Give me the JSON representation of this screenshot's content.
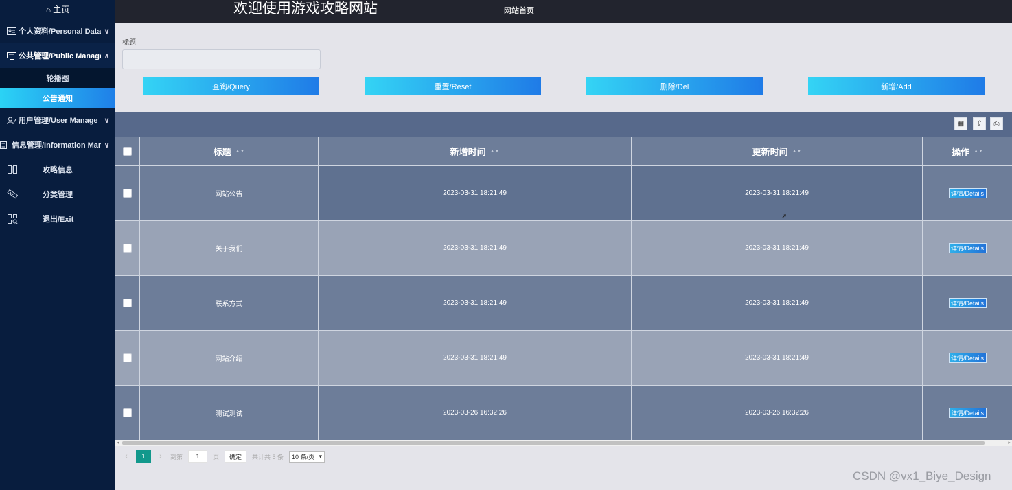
{
  "sidebar": {
    "home_label": "主页",
    "groups": [
      {
        "label": "个人资料/Personal Data",
        "chev": "∨"
      },
      {
        "label": "公共管理/Public Manage",
        "chev": "∧"
      },
      {
        "label": "用户管理/User Manage",
        "chev": "∨"
      },
      {
        "label": "信息管理/Information Manage",
        "chev": "∨"
      }
    ],
    "sub_items": [
      {
        "label": "轮播图"
      },
      {
        "label": "公告通知"
      }
    ],
    "items": [
      {
        "label": "攻略信息"
      },
      {
        "label": "分类管理"
      },
      {
        "label": "退出/Exit"
      }
    ]
  },
  "header": {
    "title": "欢迎使用游戏攻略网站",
    "home_link": "网站首页"
  },
  "search": {
    "label": "标题",
    "value": ""
  },
  "buttons": {
    "query": "查询/Query",
    "reset": "重置/Reset",
    "delete": "删除/Del",
    "add": "新增/Add"
  },
  "table": {
    "columns": [
      "标题",
      "新增时间",
      "更新时间",
      "操作"
    ],
    "sort_icon": "▲▼",
    "details_label": "详情/Details",
    "rows": [
      {
        "title": "网站公告",
        "created": "2023-03-31 18:21:49",
        "updated": "2023-03-31 18:21:49"
      },
      {
        "title": "关于我们",
        "created": "2023-03-31 18:21:49",
        "updated": "2023-03-31 18:21:49"
      },
      {
        "title": "联系方式",
        "created": "2023-03-31 18:21:49",
        "updated": "2023-03-31 18:21:49"
      },
      {
        "title": "网站介绍",
        "created": "2023-03-31 18:21:49",
        "updated": "2023-03-31 18:21:49"
      },
      {
        "title": "测试测试",
        "created": "2023-03-26 16:32:26",
        "updated": "2023-03-26 16:32:26"
      }
    ]
  },
  "pager": {
    "prev": "‹",
    "current": "1",
    "next": "›",
    "goto_label": "到第",
    "goto_value": "1",
    "page_label": "页",
    "confirm": "确定",
    "total": "共计共 5 条",
    "page_size": "10 条/页"
  },
  "watermark": "CSDN @vx1_Biye_Design",
  "colors": {
    "sidebar_bg": "#081d3e",
    "active_gradient_start": "#2bd3f5",
    "active_gradient_end": "#1f7fe8",
    "row_dark": "#5f7190",
    "row_mid": "#6d7d99",
    "row_light": "#99a3b6",
    "pager_active": "#12988c"
  }
}
